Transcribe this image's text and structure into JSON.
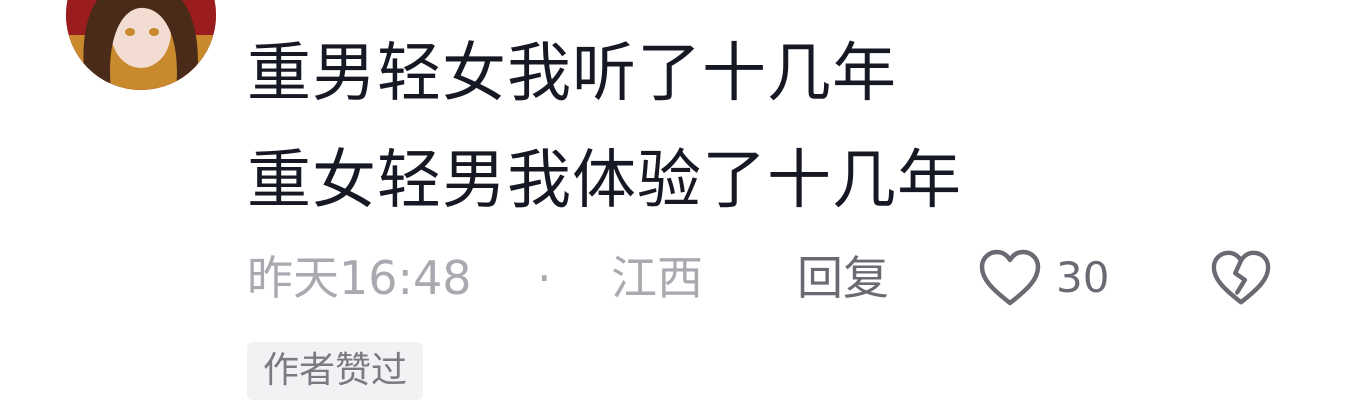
{
  "comment": {
    "lines": [
      "重男轻女我听了十几年",
      "重女轻男我体验了十几年"
    ],
    "time": "昨天16:48",
    "separator": "·",
    "location": "江西",
    "reply_label": "回复",
    "like_count": "30",
    "author_badge": "作者赞过"
  },
  "icons": {
    "like": "heart-outline-icon",
    "dislike": "broken-heart-icon"
  },
  "colors": {
    "text_primary": "#161823",
    "text_secondary": "#a9aab0",
    "action_text": "#6a6b72",
    "badge_bg": "#f2f2f4"
  }
}
